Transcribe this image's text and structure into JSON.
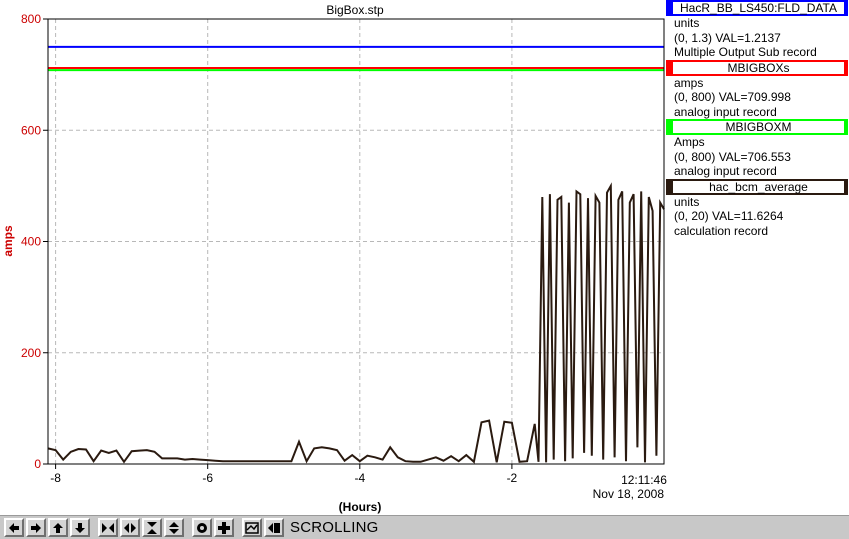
{
  "chart_data": {
    "type": "line",
    "title": "BigBox.stp",
    "xlabel": "(Hours)",
    "ylabel": "amps",
    "xlim": [
      -8.1,
      0
    ],
    "ylim": [
      0,
      800
    ],
    "grid": true,
    "x_ticks": [
      -8,
      -6,
      -4,
      -2
    ],
    "y_ticks": [
      0,
      200,
      400,
      600,
      800
    ],
    "end_time": "12:11:46",
    "end_date": "Nov 18, 2008",
    "series": [
      {
        "name": "HacR_BB_LS450:FLD_DATA",
        "color": "#0000ff",
        "line_y": 750,
        "units": "units",
        "range_value": "(0, 1.3) VAL=1.2137",
        "record": "Multiple Output Sub record"
      },
      {
        "name": "MBIGBOXs",
        "color": "#ff0000",
        "line_y": 712,
        "units": "amps",
        "range_value": "(0, 800) VAL=709.998",
        "record": "analog input record"
      },
      {
        "name": "MBIGBOXM",
        "color": "#00ff00",
        "line_y": 708,
        "units": "Amps",
        "range_value": "(0, 800) VAL=706.553",
        "record": "analog input record"
      },
      {
        "name": "hac_bcm_average",
        "color": "#2a1a10",
        "units": "units",
        "range_value": "(0, 20) VAL=11.6264",
        "record": "calculation record",
        "x": [
          -8.1,
          -8.0,
          -7.9,
          -7.8,
          -7.7,
          -7.6,
          -7.5,
          -7.4,
          -7.3,
          -7.2,
          -7.1,
          -7.0,
          -6.9,
          -6.8,
          -6.7,
          -6.6,
          -6.5,
          -6.4,
          -6.3,
          -6.2,
          -6.1,
          -6.0,
          -5.9,
          -5.8,
          -5.7,
          -5.6,
          -5.5,
          -5.4,
          -5.3,
          -5.2,
          -5.1,
          -5.0,
          -4.9,
          -4.8,
          -4.7,
          -4.6,
          -4.5,
          -4.4,
          -4.3,
          -4.2,
          -4.1,
          -4.0,
          -3.9,
          -3.8,
          -3.7,
          -3.6,
          -3.5,
          -3.4,
          -3.3,
          -3.2,
          -3.1,
          -3.0,
          -2.9,
          -2.8,
          -2.7,
          -2.6,
          -2.5,
          -2.4,
          -2.3,
          -2.2,
          -2.1,
          -2.0,
          -1.9,
          -1.8,
          -1.7,
          -1.65,
          -1.6,
          -1.55,
          -1.5,
          -1.45,
          -1.4,
          -1.35,
          -1.3,
          -1.25,
          -1.2,
          -1.15,
          -1.1,
          -1.05,
          -1.0,
          -0.95,
          -0.9,
          -0.85,
          -0.8,
          -0.75,
          -0.7,
          -0.65,
          -0.6,
          -0.55,
          -0.5,
          -0.45,
          -0.4,
          -0.35,
          -0.3,
          -0.25,
          -0.2,
          -0.15,
          -0.1,
          -0.05,
          0
        ],
        "values": [
          28,
          25,
          8,
          22,
          27,
          26,
          5,
          24,
          20,
          24,
          4,
          23,
          24,
          25,
          22,
          10,
          10,
          10,
          8,
          9,
          8,
          7,
          6,
          5,
          5,
          5,
          5,
          5,
          5,
          5,
          5,
          5,
          5,
          40,
          5,
          28,
          30,
          28,
          25,
          6,
          16,
          5,
          15,
          12,
          8,
          30,
          12,
          5,
          4,
          4,
          8,
          12,
          6,
          14,
          5,
          16,
          4,
          75,
          78,
          3,
          76,
          74,
          4,
          5,
          72,
          4,
          480,
          3,
          485,
          8,
          475,
          480,
          5,
          470,
          10,
          490,
          485,
          20,
          478,
          15,
          482,
          470,
          8,
          488,
          500,
          12,
          475,
          490,
          5,
          470,
          485,
          30,
          490,
          3,
          480,
          455,
          15,
          470,
          458
        ]
      }
    ]
  },
  "toolbar": {
    "icons": [
      "arrow-left-icon",
      "arrow-right-icon",
      "arrow-up-icon",
      "arrow-down-icon",
      "shrink-horizontal-icon",
      "expand-horizontal-icon",
      "shrink-vertical-icon",
      "expand-vertical-icon",
      "record-icon",
      "add-icon",
      "autoscale-icon",
      "scroll-back-icon"
    ],
    "status": "SCROLLING"
  }
}
